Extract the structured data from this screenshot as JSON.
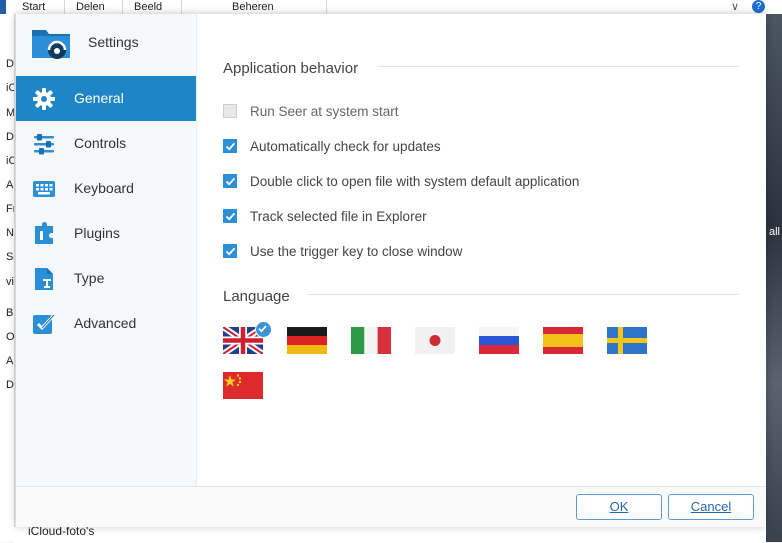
{
  "background_window": {
    "ribbon_tabs": [
      "Start",
      "Delen",
      "Beeld",
      "Beheren"
    ],
    "left_edge_chars": [
      "D",
      "iC",
      "M",
      "D",
      "iC",
      "A",
      "Fr",
      "N",
      "Sc",
      "vi",
      "Bur",
      "O",
      "A",
      "D"
    ],
    "right_edge_text": "all",
    "bottom_file": "iCloud-foto's",
    "help_label": "?",
    "chevron": "∨"
  },
  "dialog": {
    "title": "Settings",
    "nav": [
      {
        "label": "General",
        "icon": "gear-icon",
        "active": true
      },
      {
        "label": "Controls",
        "icon": "sliders-icon",
        "active": false
      },
      {
        "label": "Keyboard",
        "icon": "keyboard-icon",
        "active": false
      },
      {
        "label": "Plugins",
        "icon": "puzzle-icon",
        "active": false
      },
      {
        "label": "Type",
        "icon": "file-type-icon",
        "active": false
      },
      {
        "label": "Advanced",
        "icon": "checkbox-icon",
        "active": false
      }
    ],
    "sections": {
      "behavior_title": "Application behavior",
      "language_title": "Language"
    },
    "options": [
      {
        "label": "Run Seer at system start",
        "checked": false
      },
      {
        "label": "Automatically check for updates",
        "checked": true
      },
      {
        "label": "Double click to open file with system default application",
        "checked": true
      },
      {
        "label": "Track selected file in Explorer",
        "checked": true
      },
      {
        "label": "Use the trigger key to close window",
        "checked": true
      }
    ],
    "languages": [
      {
        "flag": "uk-flag-icon",
        "selected": true
      },
      {
        "flag": "germany-flag-icon",
        "selected": false
      },
      {
        "flag": "italy-flag-icon",
        "selected": false
      },
      {
        "flag": "japan-flag-icon",
        "selected": false
      },
      {
        "flag": "russia-flag-icon",
        "selected": false
      },
      {
        "flag": "spain-flag-icon",
        "selected": false
      },
      {
        "flag": "sweden-flag-icon",
        "selected": false
      },
      {
        "flag": "china-flag-icon",
        "selected": false
      }
    ],
    "buttons": {
      "ok": "OK",
      "cancel": "Cancel"
    },
    "colors": {
      "accent": "#1e86c6",
      "checkbox": "#2d8fd5",
      "sidebar_bg": "#f5f9fc"
    }
  }
}
